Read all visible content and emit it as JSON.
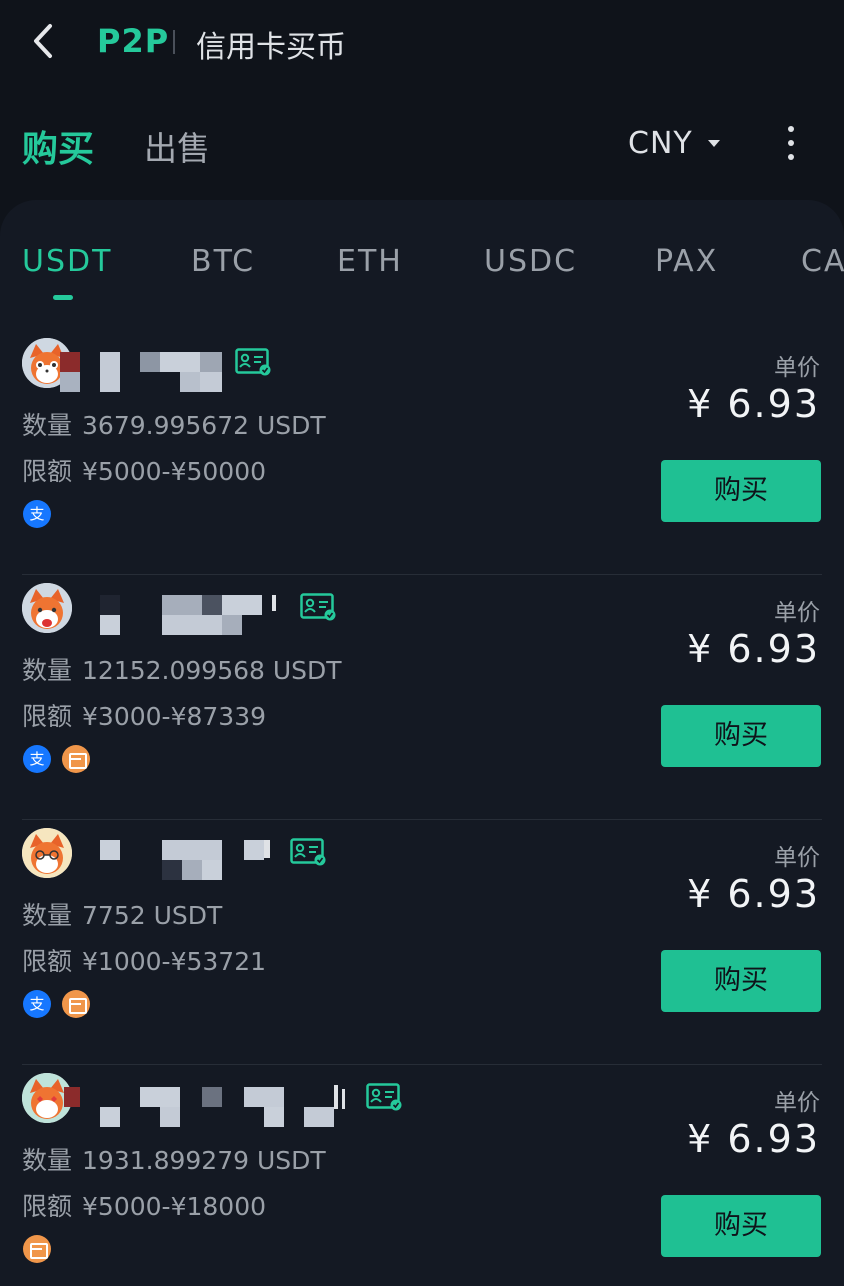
{
  "header": {
    "brand": "P2P",
    "title": "信用卡买币"
  },
  "side_tabs": {
    "buy": "购买",
    "sell": "出售"
  },
  "currency": "CNY",
  "coin_tabs": [
    "USDT",
    "BTC",
    "ETH",
    "USDC",
    "PAX",
    "CA"
  ],
  "labels": {
    "unit_price": "单价",
    "quantity": "数量",
    "limit": "限额",
    "buy": "购买",
    "alipay_glyph": "支"
  },
  "colors": {
    "accent": "#25c99b",
    "background": "#0f131a",
    "panel": "#141923",
    "alipay": "#1677ff",
    "card_payment": "#f0964a"
  },
  "offers": [
    {
      "quantity": "3679.995672 USDT",
      "limit": "¥5000-¥50000",
      "price": "¥ 6.93",
      "payments": [
        "alipay"
      ]
    },
    {
      "quantity": "12152.099568 USDT",
      "limit": "¥3000-¥87339",
      "price": "¥ 6.93",
      "payments": [
        "alipay",
        "card"
      ]
    },
    {
      "quantity": "7752 USDT",
      "limit": "¥1000-¥53721",
      "price": "¥ 6.93",
      "payments": [
        "alipay",
        "card"
      ]
    },
    {
      "quantity": "1931.899279 USDT",
      "limit": "¥5000-¥18000",
      "price": "¥ 6.93",
      "payments": [
        "card"
      ]
    }
  ]
}
